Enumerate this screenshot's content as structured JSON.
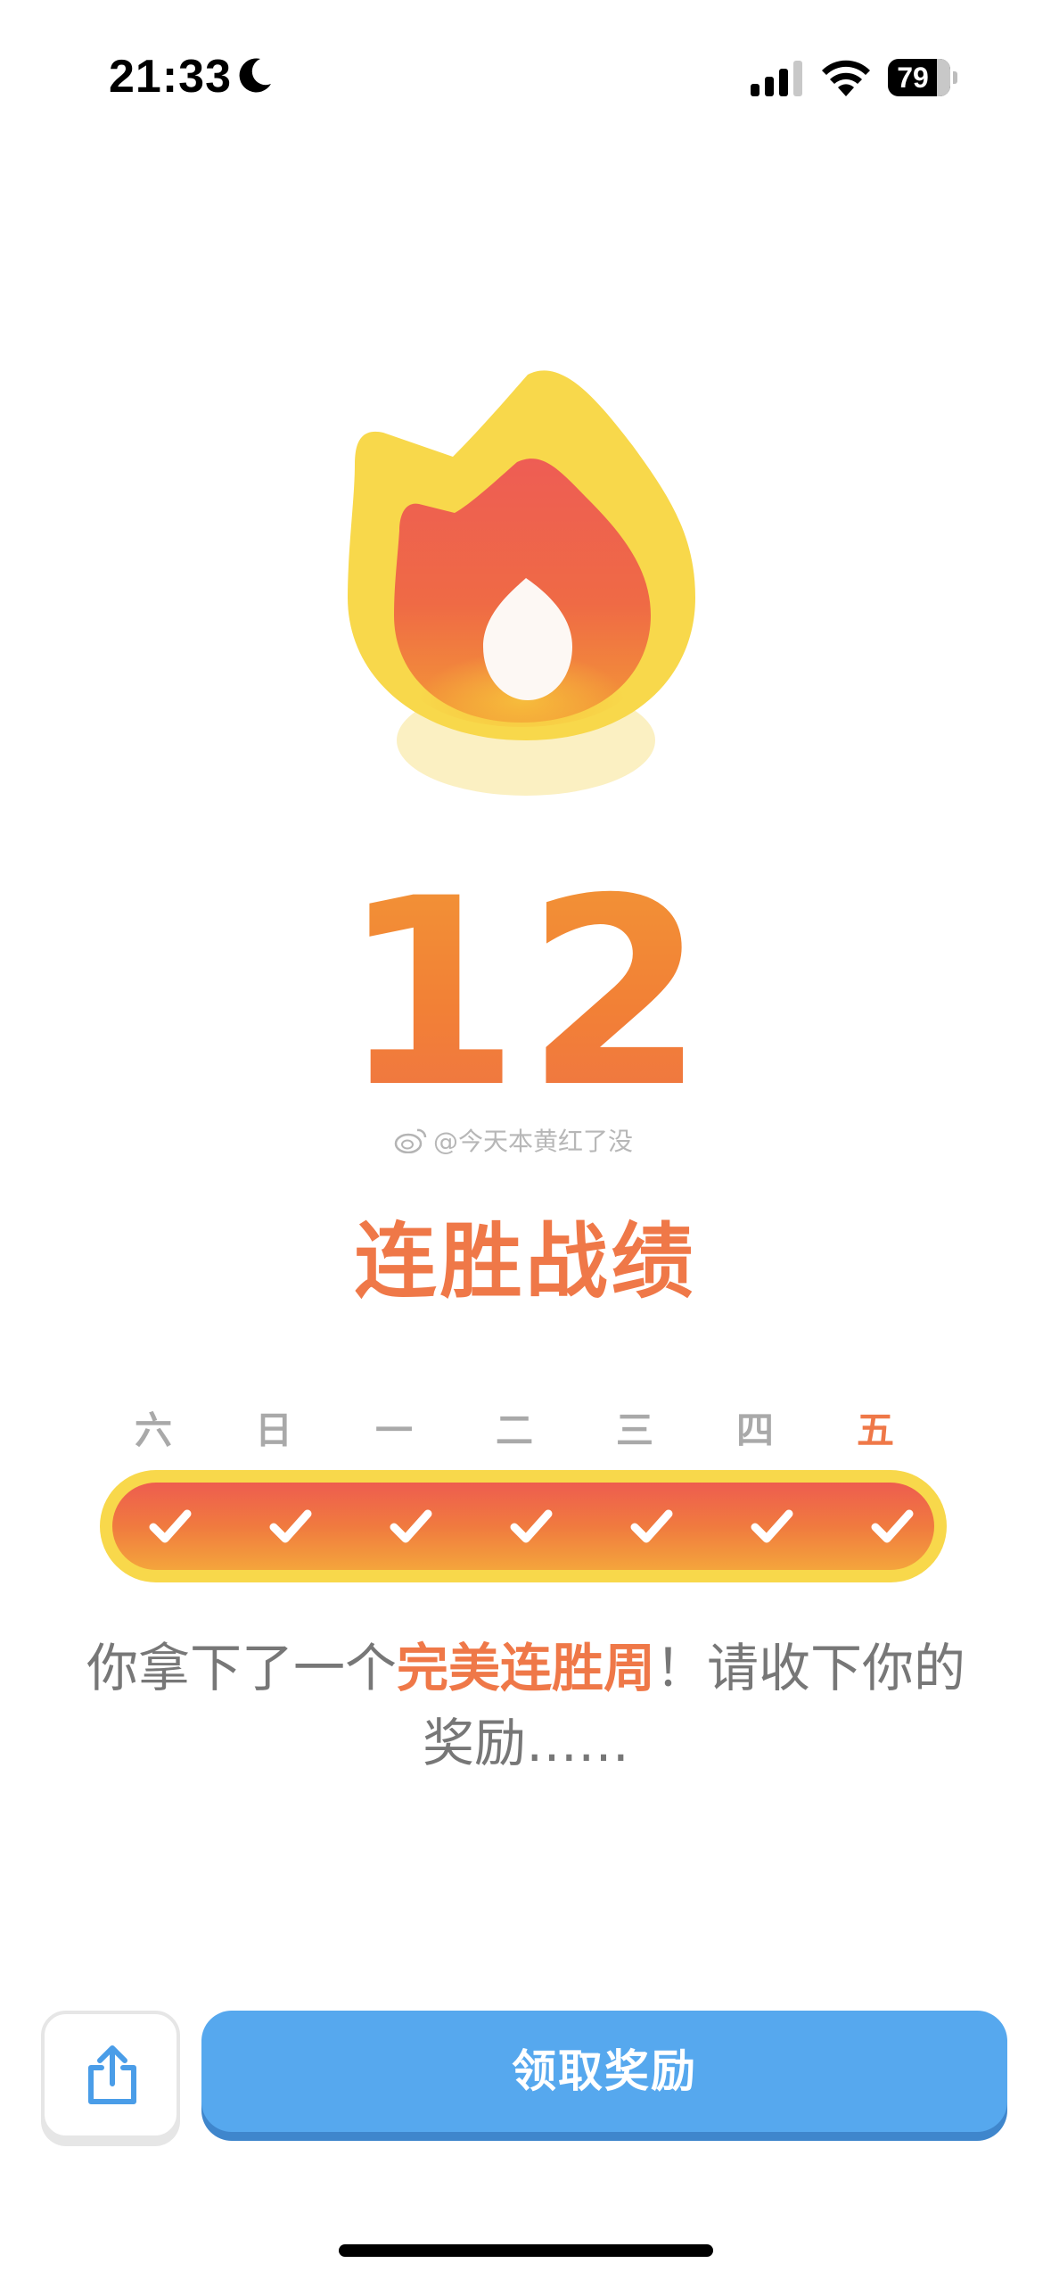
{
  "status_bar": {
    "time": "21:33",
    "battery_level": "79",
    "icons": [
      "moon-icon",
      "signal-icon",
      "wifi-icon",
      "battery-icon"
    ]
  },
  "streak": {
    "count": "12",
    "title": "连胜战绩"
  },
  "watermark": {
    "text": "@今天本黄红了没",
    "icon": "weibo-icon"
  },
  "week": {
    "days": [
      {
        "label": "六",
        "completed": true,
        "current": false
      },
      {
        "label": "日",
        "completed": true,
        "current": false
      },
      {
        "label": "一",
        "completed": true,
        "current": false
      },
      {
        "label": "二",
        "completed": true,
        "current": false
      },
      {
        "label": "三",
        "completed": true,
        "current": false
      },
      {
        "label": "四",
        "completed": true,
        "current": false
      },
      {
        "label": "五",
        "completed": true,
        "current": true
      }
    ]
  },
  "message": {
    "prefix": "你拿下了一个",
    "highlight": "完美连胜周",
    "suffix": "！请收下你的奖励……"
  },
  "actions": {
    "share_icon": "share-icon",
    "claim_label": "领取奖励"
  },
  "colors": {
    "accent_orange": "#ef7848",
    "flame_yellow": "#f8d84b",
    "button_blue": "#56a8ee",
    "muted_gray": "#a9a9a9"
  }
}
